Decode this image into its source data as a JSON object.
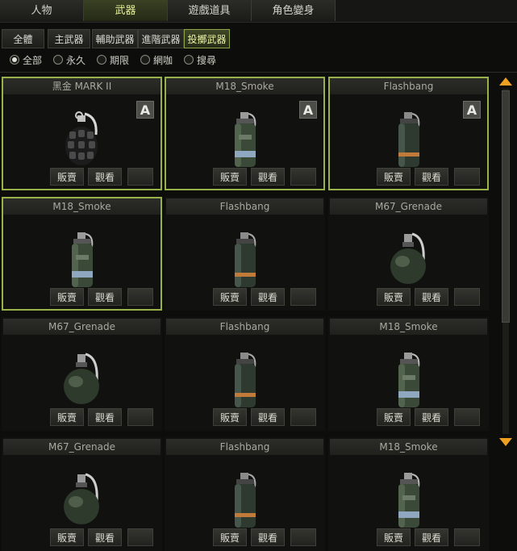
{
  "top_tabs": [
    {
      "label": "人物",
      "active": false
    },
    {
      "label": "武器",
      "active": true
    },
    {
      "label": "遊戲道具",
      "active": false
    },
    {
      "label": "角色變身",
      "active": false
    }
  ],
  "sub_tabs": [
    {
      "label": "全體",
      "active": false
    },
    {
      "label": "主武器",
      "active": false
    },
    {
      "label": "輔助武器",
      "active": false
    },
    {
      "label": "進階武器",
      "active": false
    },
    {
      "label": "投擲武器",
      "active": true
    }
  ],
  "filters": [
    {
      "label": "全部",
      "selected": true
    },
    {
      "label": "永久",
      "selected": false
    },
    {
      "label": "期限",
      "selected": false
    },
    {
      "label": "網咖",
      "selected": false
    },
    {
      "label": "搜尋",
      "selected": false
    }
  ],
  "button_labels": {
    "sell": "販賣",
    "view": "觀看"
  },
  "items": [
    {
      "name": "黑金 MARK II",
      "badge": "A",
      "selected": true,
      "icon": "frag-grenade-icon"
    },
    {
      "name": "M18_Smoke",
      "badge": "A",
      "selected": true,
      "icon": "smoke-grenade-icon"
    },
    {
      "name": "Flashbang",
      "badge": "A",
      "selected": true,
      "icon": "flashbang-icon"
    },
    {
      "name": "M18_Smoke",
      "badge": "",
      "selected": true,
      "icon": "smoke-grenade-icon"
    },
    {
      "name": "Flashbang",
      "badge": "",
      "selected": false,
      "icon": "flashbang-icon"
    },
    {
      "name": "M67_Grenade",
      "badge": "",
      "selected": false,
      "icon": "m67-grenade-icon"
    },
    {
      "name": "M67_Grenade",
      "badge": "",
      "selected": false,
      "icon": "m67-grenade-icon"
    },
    {
      "name": "Flashbang",
      "badge": "",
      "selected": false,
      "icon": "flashbang-icon"
    },
    {
      "name": "M18_Smoke",
      "badge": "",
      "selected": false,
      "icon": "smoke-grenade-icon"
    },
    {
      "name": "M67_Grenade",
      "badge": "",
      "selected": false,
      "icon": "m67-grenade-icon"
    },
    {
      "name": "Flashbang",
      "badge": "",
      "selected": false,
      "icon": "flashbang-icon"
    },
    {
      "name": "M18_Smoke",
      "badge": "",
      "selected": false,
      "icon": "smoke-grenade-icon"
    }
  ],
  "colors": {
    "accent": "#99b14a",
    "scroll_arrow": "#f0a020",
    "background": "#0d0e0c"
  }
}
